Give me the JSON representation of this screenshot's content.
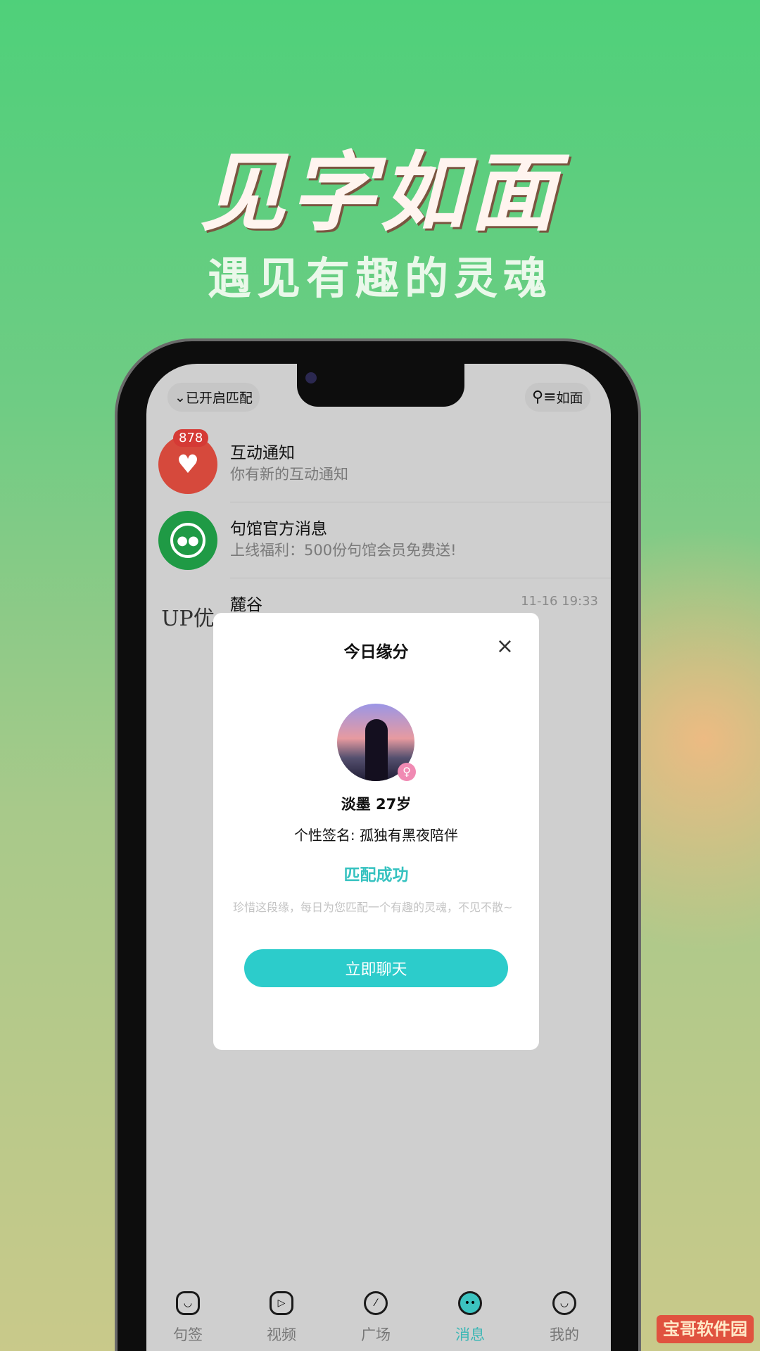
{
  "hero": {
    "title": "见字如面",
    "subtitle": "遇见有趣的灵魂"
  },
  "header": {
    "match_toggle": "已开启匹配",
    "match_chevron": "⌄",
    "profile_button": "如面",
    "profile_icon": "person-list-icon"
  },
  "messages": [
    {
      "title": "互动通知",
      "subtitle": "你有新的互动通知",
      "badge": "878",
      "icon": "hearts-icon",
      "color": "#d6493c"
    },
    {
      "title": "句馆官方消息",
      "subtitle": "上线福利：500份句馆会员免费送!",
      "icon": "chat-bubble-icon",
      "color": "#1f9a45"
    },
    {
      "title": "麓谷",
      "time": "11-16 19:33",
      "avatar_text": "UP优"
    }
  ],
  "modal": {
    "title": "今日缘分",
    "close": "×",
    "name": "淡墨 27岁",
    "signature": "个性签名: 孤独有黑夜陪伴",
    "status": "匹配成功",
    "hint": "珍惜这段缘，每日为您匹配一个有趣的灵魂，不见不散~",
    "button": "立即聊天",
    "gender_icon": "female-icon",
    "accent": "#2ccccb"
  },
  "tabs": [
    {
      "label": "句签",
      "icon": "home-icon",
      "active": false
    },
    {
      "label": "视频",
      "icon": "play-icon",
      "active": false
    },
    {
      "label": "广场",
      "icon": "compass-icon",
      "active": false
    },
    {
      "label": "消息",
      "icon": "message-icon",
      "active": true
    },
    {
      "label": "我的",
      "icon": "smile-icon",
      "active": false
    }
  ],
  "watermark": "宝哥软件园"
}
